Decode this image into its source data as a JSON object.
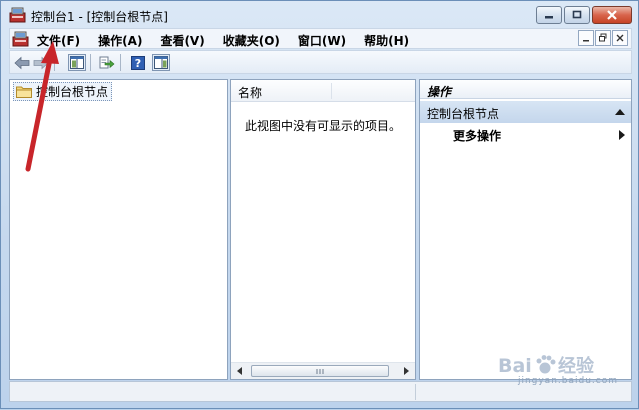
{
  "window": {
    "title": "控制台1 - [控制台根节点]"
  },
  "menu": {
    "items": [
      {
        "label": "文件(F)"
      },
      {
        "label": "操作(A)"
      },
      {
        "label": "查看(V)"
      },
      {
        "label": "收藏夹(O)"
      },
      {
        "label": "窗口(W)"
      },
      {
        "label": "帮助(H)"
      }
    ]
  },
  "toolbar": {
    "icons": [
      "back-arrow-icon",
      "forward-arrow-icon",
      "show-hide-tree-icon",
      "export-list-icon",
      "help-icon",
      "show-hide-action-pane-icon"
    ]
  },
  "tree": {
    "root_label": "控制台根节点"
  },
  "list": {
    "column_name": "名称",
    "empty_message": "此视图中没有可显示的项目。"
  },
  "actions": {
    "header": "操作",
    "group_title": "控制台根节点",
    "more_actions": "更多操作"
  },
  "watermark": {
    "text": "Bai du 经验",
    "url": "jingyan.baidu.com"
  },
  "colors": {
    "annotation_arrow": "#c8252a",
    "action_group_bg": "#c4d6ec",
    "window_frame": "#c5d8ee"
  }
}
